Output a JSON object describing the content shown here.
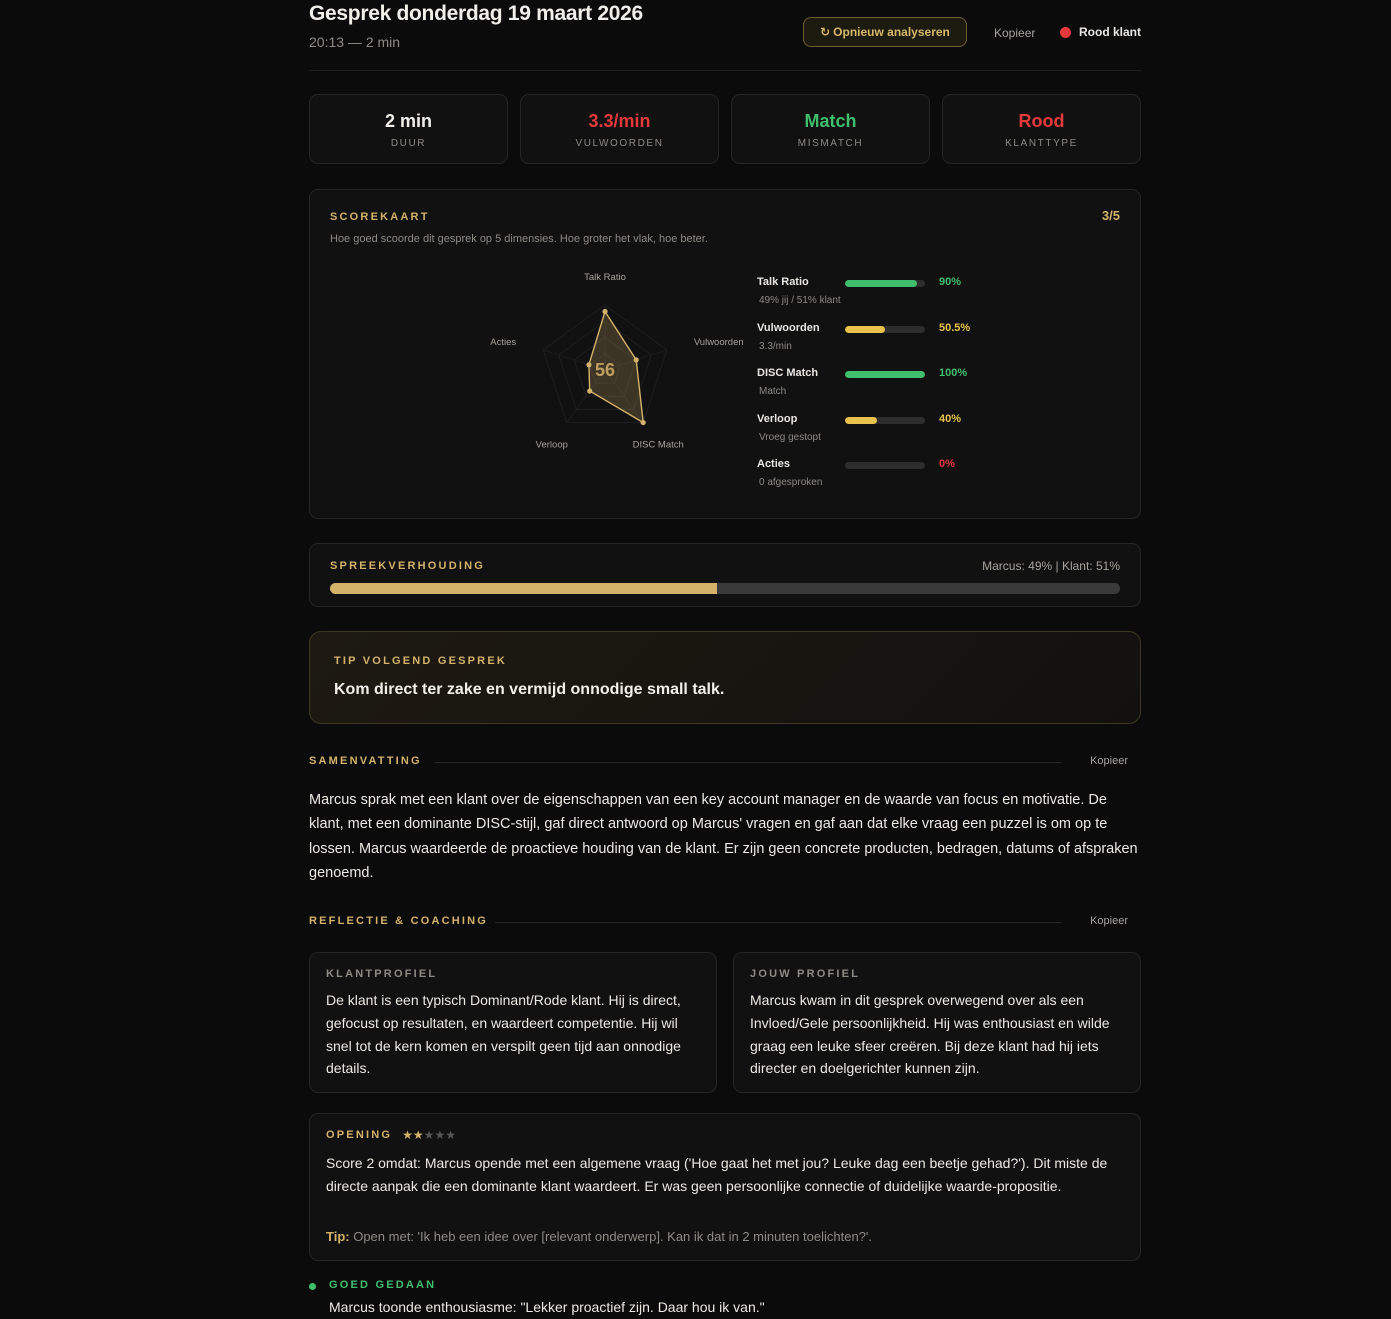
{
  "header": {
    "title": "Gesprek donderdag 19 maart 2026",
    "subtitle": "20:13 — 2 min",
    "reanalyse_label": "Opnieuw analyseren",
    "copy_label": "Kopieer",
    "client_type_label": "Rood klant"
  },
  "stats": [
    {
      "value": "2 min",
      "label": "DUUR",
      "color": "#f1efe9"
    },
    {
      "value": "3.3/min",
      "label": "VULWOORDEN",
      "color": "#e5393b"
    },
    {
      "value": "Match",
      "label": "MISMATCH",
      "color": "#3fbf6e"
    },
    {
      "value": "Rood",
      "label": "KLANTTYPE",
      "color": "#e5393b"
    }
  ],
  "scorecard": {
    "label": "SCOREKAART",
    "score": "3/5",
    "description": "Hoe goed scoorde dit gesprek op 5 dimensies. Hoe groter het vlak, hoe beter.",
    "center_value": "56",
    "axes": [
      "Talk Ratio",
      "Vulwoorden",
      "DISC Match",
      "Verloop",
      "Acties"
    ],
    "values": [
      90,
      50.5,
      100,
      40,
      0
    ],
    "metrics": [
      {
        "name": "Talk Ratio",
        "sub": "49% jij / 51% klant",
        "value": 90,
        "pct": "90%",
        "color": "#3fbf6e"
      },
      {
        "name": "Vulwoorden",
        "sub": "3.3/min",
        "value": 50.5,
        "pct": "50.5%",
        "color": "#e8c24a"
      },
      {
        "name": "DISC Match",
        "sub": "Match",
        "value": 100,
        "pct": "100%",
        "color": "#3fbf6e"
      },
      {
        "name": "Verloop",
        "sub": "Vroeg gestopt",
        "value": 40,
        "pct": "40%",
        "color": "#e8c24a"
      },
      {
        "name": "Acties",
        "sub": "0 afgesproken",
        "value": 0,
        "pct": "0%",
        "color": "#e5393b"
      }
    ]
  },
  "spreekverhouding": {
    "label": "SPREEKVERHOUDING",
    "text": "Marcus: 49% | Klant: 51%",
    "marcus_share": 49
  },
  "tip": {
    "label": "TIP VOLGEND GESPREK",
    "text": "Kom direct ter zake en vermijd onnodige small talk."
  },
  "samenvatting": {
    "label": "SAMENVATTING",
    "copy_label": "Kopieer",
    "text": "Marcus sprak met een klant over de eigenschappen van een key account manager en de waarde van focus en motivatie. De klant, met een dominante DISC-stijl, gaf direct antwoord op Marcus' vragen en gaf aan dat elke vraag een puzzel is om op te lossen. Marcus waardeerde de proactieve houding van de klant. Er zijn geen concrete producten, bedragen, datums of afspraken genoemd."
  },
  "reflectie": {
    "label": "REFLECTIE & COACHING",
    "copy_label": "Kopieer",
    "klantprofiel_label": "KLANTPROFIEL",
    "klantprofiel_text": "De klant is een typisch Dominant/Rode klant. Hij is direct, gefocust op resultaten, en waardeert competentie. Hij wil snel tot de kern komen en verspilt geen tijd aan onnodige details.",
    "jouwprofiel_label": "JOUW PROFIEL",
    "jouwprofiel_text": "Marcus kwam in dit gesprek overwegend over als een Invloed/Gele persoonlijkheid. Hij was enthousiast en wilde graag een leuke sfeer creëren. Bij deze klant had hij iets directer en doelgerichter kunnen zijn."
  },
  "opening": {
    "label": "OPENING",
    "stars": 2,
    "stars_max": 5,
    "text": "Score 2 omdat: Marcus opende met een algemene vraag ('Hoe gaat het met jou? Leuke dag een beetje gehad?'). Dit miste de directe aanpak die een dominante klant waardeert. Er was geen persoonlijke connectie of duidelijke waarde-propositie.",
    "tip_label": "Tip:",
    "tip_text": "Open met: 'Ik heb een idee over [relevant onderwerp]. Kan ik dat in 2 minuten toelichten?'."
  },
  "goed_gedaan": {
    "label": "GOED GEDAAN",
    "text": "Marcus toonde enthousiasme: \"Lekker proactief zijn. Daar hou ik van.\""
  },
  "colors": {
    "accent": "#d4b26a",
    "green": "#3fbf6e",
    "yellow": "#e8c24a",
    "red": "#e5393b"
  }
}
